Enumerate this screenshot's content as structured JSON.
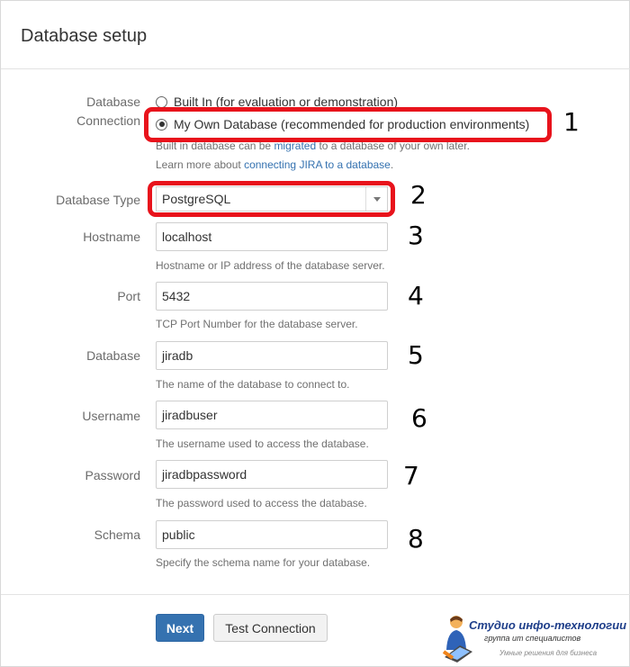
{
  "page": {
    "title": "Database setup"
  },
  "connection": {
    "label_line1": "Database",
    "label_line2": "Connection",
    "options": [
      {
        "label": "Built In (for evaluation or demonstration)",
        "checked": false
      },
      {
        "label": "My Own Database (recommended for production environments)",
        "checked": true
      }
    ],
    "help_line1_before": "Built in database can be ",
    "help_line1_link": "migrated",
    "help_line1_after": " to a database of your own later.",
    "help_line2_before": "Learn more about ",
    "help_line2_link": "connecting JIRA to a database",
    "help_line2_after": "."
  },
  "db_type": {
    "label": "Database Type",
    "value": "PostgreSQL"
  },
  "fields": {
    "hostname": {
      "label": "Hostname",
      "value": "localhost",
      "help": "Hostname or IP address of the database server."
    },
    "port": {
      "label": "Port",
      "value": "5432",
      "help": "TCP Port Number for the database server."
    },
    "database": {
      "label": "Database",
      "value": "jiradb",
      "help": "The name of the database to connect to."
    },
    "username": {
      "label": "Username",
      "value": "jiradbuser",
      "help": "The username used to access the database."
    },
    "password": {
      "label": "Password",
      "value": "jiradbpassword",
      "help": "The password used to access the database."
    },
    "schema": {
      "label": "Schema",
      "value": "public",
      "help": "Specify the schema name for your database."
    }
  },
  "annotations": [
    "1",
    "2",
    "3",
    "4",
    "5",
    "6",
    "7",
    "8"
  ],
  "buttons": {
    "next": "Next",
    "test": "Test Connection"
  },
  "watermark": {
    "title": "Студио инфо-технологии",
    "subtitle": "группа ит специалистов",
    "tagline": "Умные решения для бизнеса"
  },
  "colors": {
    "accent": "#3572b0",
    "highlight": "#e8131c"
  }
}
